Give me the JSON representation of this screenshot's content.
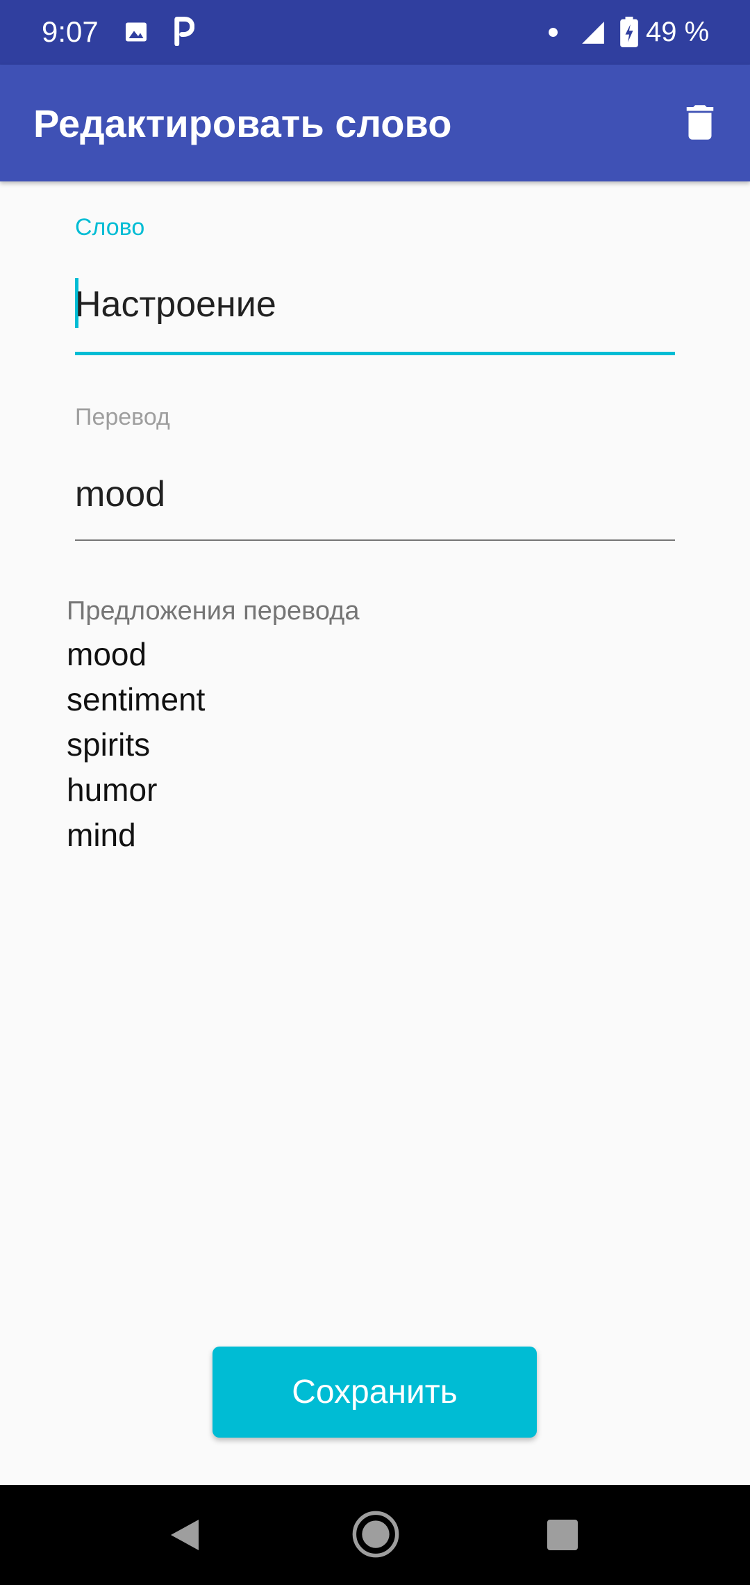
{
  "status_bar": {
    "time": "9:07",
    "battery": "49 %",
    "icons": [
      "image-icon",
      "p-icon",
      "dot-icon",
      "signal-icon",
      "battery-icon"
    ]
  },
  "app_bar": {
    "title": "Редактировать слово",
    "actions": [
      "delete-icon"
    ]
  },
  "form": {
    "word": {
      "label": "Слово",
      "value": "Настроение"
    },
    "translation": {
      "label": "Перевод",
      "value": "mood"
    }
  },
  "suggestions": {
    "title": "Предложения перевода",
    "items": [
      "mood",
      "sentiment",
      "spirits",
      "humor",
      "mind"
    ]
  },
  "save_button": {
    "label": "Сохранить"
  },
  "colors": {
    "status_bar": "#303f9f",
    "app_bar": "#3f51b5",
    "accent": "#00bcd4",
    "background": "#fafafa",
    "nav_bar": "#000000"
  }
}
